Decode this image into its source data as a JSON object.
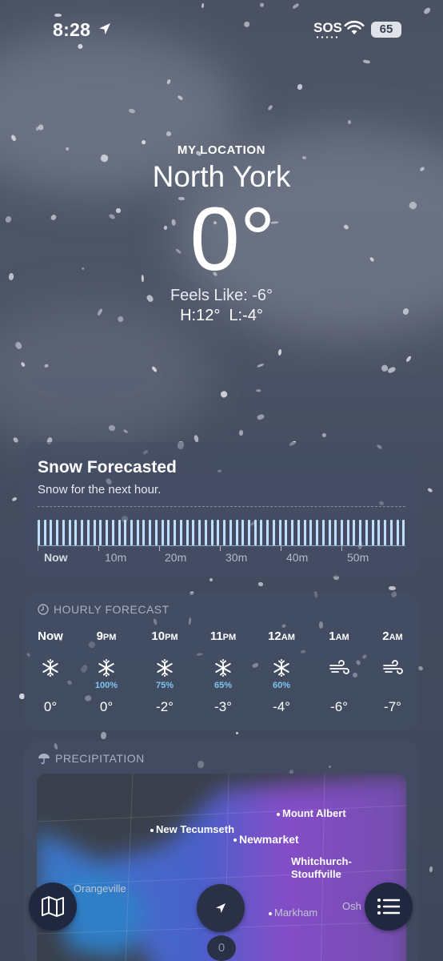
{
  "status_bar": {
    "time": "8:28",
    "carrier": "SOS",
    "battery": "65"
  },
  "hero": {
    "location_label": "MY LOCATION",
    "city": "North York",
    "temperature": "0°",
    "feels_like": "Feels Like: -6°",
    "high_low": "H:12°  L:-4°"
  },
  "snow_card": {
    "title": "Snow Forecasted",
    "subtitle": "Snow for the next hour.",
    "time_labels": [
      "Now",
      "10m",
      "20m",
      "30m",
      "40m",
      "50m"
    ],
    "bar_color": "#bfe0fb"
  },
  "hourly": {
    "header": "HOURLY FORECAST",
    "items": [
      {
        "time": "Now",
        "suffix": "",
        "icon": "snowflake-icon",
        "pct": "",
        "temp": "0°"
      },
      {
        "time": "9",
        "suffix": "PM",
        "icon": "snowflake-icon",
        "pct": "100%",
        "temp": "0°"
      },
      {
        "time": "10",
        "suffix": "PM",
        "icon": "snowflake-icon",
        "pct": "75%",
        "temp": "-2°"
      },
      {
        "time": "11",
        "suffix": "PM",
        "icon": "snowflake-icon",
        "pct": "65%",
        "temp": "-3°"
      },
      {
        "time": "12",
        "suffix": "AM",
        "icon": "snowflake-icon",
        "pct": "60%",
        "temp": "-4°"
      },
      {
        "time": "1",
        "suffix": "AM",
        "icon": "wind-icon",
        "pct": "",
        "temp": "-6°"
      },
      {
        "time": "2",
        "suffix": "AM",
        "icon": "wind-icon",
        "pct": "",
        "temp": "-7°"
      }
    ],
    "pct_color": "#7fc4f2"
  },
  "precipitation": {
    "header": "PRECIPITATION",
    "places": [
      "Mount Albert",
      "New Tecumseth",
      "Newmarket",
      "Whitchurch-Stouffville",
      "Orangeville",
      "Markham",
      "Osh"
    ]
  },
  "bottom_bar": {
    "badge": "0"
  },
  "colors": {
    "accent_blue": "#7fc4f2",
    "fab_bg": "#20283f"
  }
}
